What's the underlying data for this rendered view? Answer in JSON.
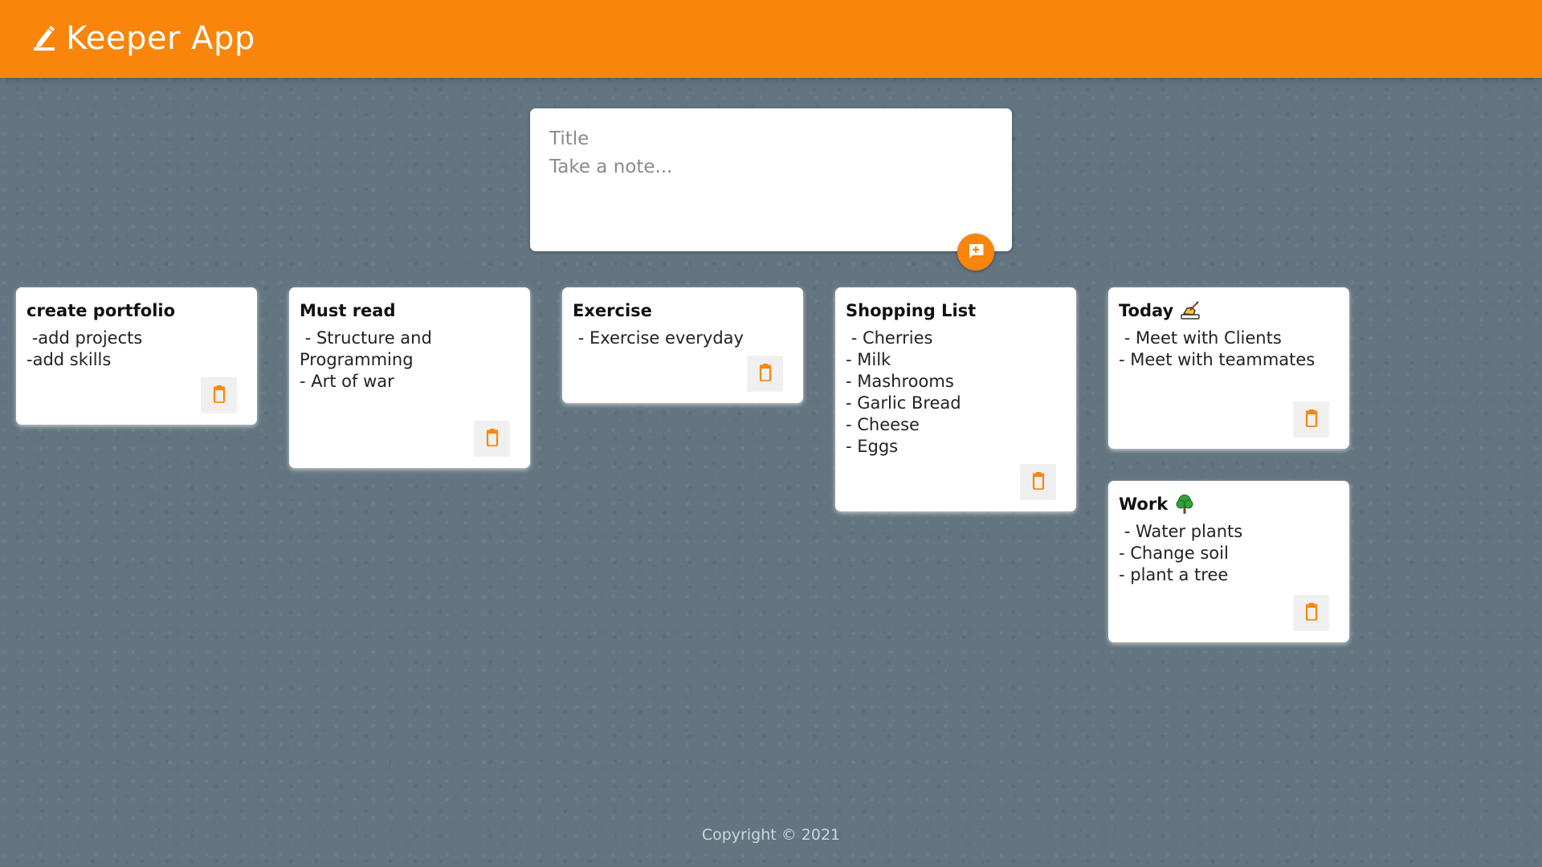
{
  "app": {
    "title": "Keeper App",
    "accent_color": "#f9850a",
    "icon": "pencil-icon"
  },
  "create_area": {
    "title_placeholder": "Title",
    "content_placeholder": "Take a note...",
    "title_value": "",
    "content_value": "",
    "add_button_icon": "add-comment-icon"
  },
  "notes": [
    {
      "title": "create portfolio",
      "content": " -add projects\n-add skills",
      "emoji": "",
      "delete_icon": "trash-icon"
    },
    {
      "title": "Must read",
      "content": " - Structure and Programming\n- Art of war",
      "emoji": "",
      "delete_icon": "trash-icon"
    },
    {
      "title": "Exercise",
      "content": " - Exercise everyday",
      "emoji": "",
      "delete_icon": "trash-icon"
    },
    {
      "title": "Shopping List",
      "content": " - Cherries\n- Milk\n- Mashrooms\n- Garlic Bread\n- Cheese\n- Eggs",
      "emoji": "",
      "delete_icon": "trash-icon"
    },
    {
      "title": "Today",
      "content": " - Meet with Clients\n- Meet with teammates",
      "emoji": "writing-hand-icon",
      "delete_icon": "trash-icon"
    },
    {
      "title": "Work",
      "content": " - Water plants\n- Change soil\n- plant a tree",
      "emoji": "tree-icon",
      "delete_icon": "trash-icon"
    }
  ],
  "footer": {
    "text": "Copyright © 2021"
  }
}
